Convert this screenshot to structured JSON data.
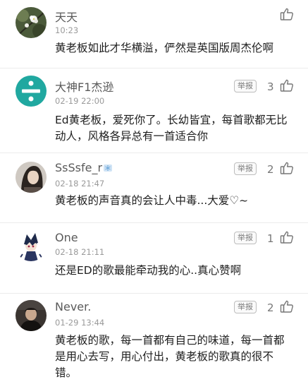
{
  "comments": [
    {
      "user": "天天",
      "time": "10:23",
      "text": "黄老板如此才华横溢，俨然是英国版周杰伦啊",
      "report": "",
      "likes": "",
      "avatar": "flower-photo-avatar"
    },
    {
      "user": "大神F1杰逊",
      "time": "02-19 22:00",
      "text": "Ed黄老板，爱死你了。长幼皆宜，每首歌都无比动人，风格各异总有一首适合你",
      "report": "举报",
      "likes": "3",
      "avatar": "divide-symbol-avatar"
    },
    {
      "user": "SsSsfe_r",
      "time": "02-18 21:47",
      "text": "黄老板的声音真的会让人中毒...大爱♡~",
      "report": "举报",
      "likes": "2",
      "avatar": "girl-photo-avatar"
    },
    {
      "user": "One",
      "time": "02-18 21:11",
      "text": "还是ED的歌最能牵动我的心..真心赞啊",
      "report": "举报",
      "likes": "1",
      "avatar": "anime-character-avatar"
    },
    {
      "user": "Never.",
      "time": "01-29 13:44",
      "text": "黄老板的歌，每一首都有自己的味道，每一首都是用心去写，用心付出，黄老板的歌真的很不错。",
      "report": "举报",
      "likes": "2",
      "avatar": "man-photo-avatar"
    }
  ]
}
